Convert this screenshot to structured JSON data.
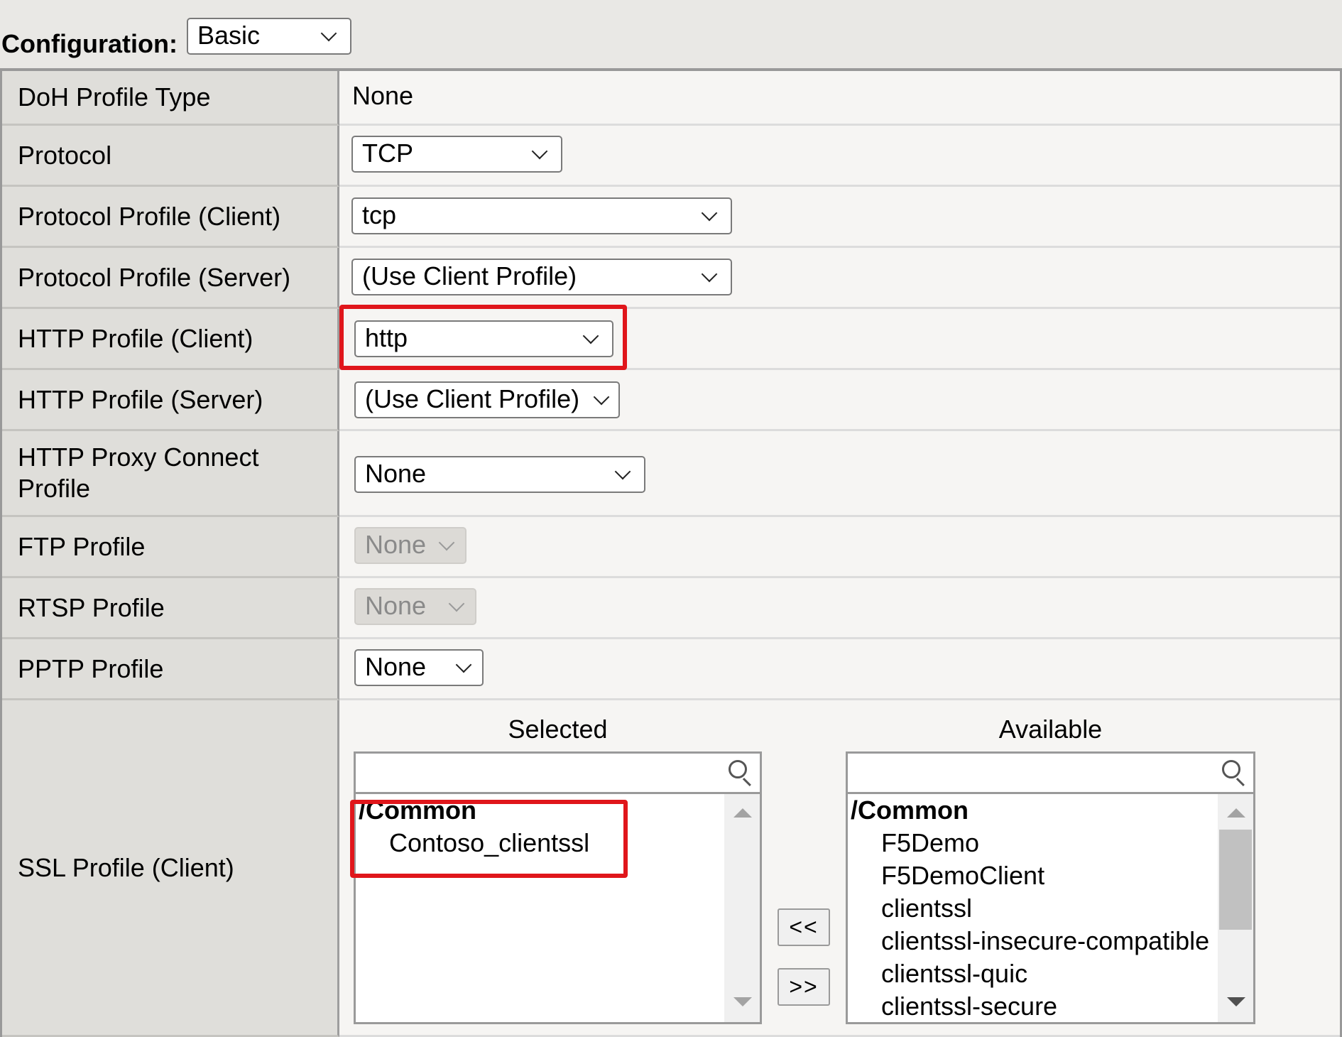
{
  "config": {
    "label": "Configuration:",
    "value": "Basic"
  },
  "rows": {
    "doh": {
      "label": "DoH Profile Type",
      "value": "None"
    },
    "protocol": {
      "label": "Protocol",
      "value": "TCP"
    },
    "protocol_client": {
      "label": "Protocol Profile (Client)",
      "value": "tcp"
    },
    "protocol_server": {
      "label": "Protocol Profile (Server)",
      "value": "(Use Client Profile)"
    },
    "http_client": {
      "label": "HTTP Profile (Client)",
      "value": "http",
      "highlighted": true
    },
    "http_server": {
      "label": "HTTP Profile (Server)",
      "value": "(Use Client Profile)"
    },
    "http_proxy": {
      "label_line1": "HTTP Proxy Connect",
      "label_line2": "Profile",
      "value": "None"
    },
    "ftp": {
      "label": "FTP Profile",
      "value": "None",
      "disabled": true
    },
    "rtsp": {
      "label": "RTSP Profile",
      "value": "None",
      "disabled": true
    },
    "pptp": {
      "label": "PPTP Profile",
      "value": "None"
    },
    "ssl_client": {
      "label": "SSL Profile (Client)",
      "selected": {
        "heading": "Selected",
        "search_value": "",
        "group": "/Common",
        "items": [
          "Contoso_clientssl"
        ],
        "highlighted": true
      },
      "buttons": {
        "add": "<<",
        "remove": ">>"
      },
      "available": {
        "heading": "Available",
        "search_value": "",
        "group": "/Common",
        "items": [
          "F5Demo",
          "F5DemoClient",
          "clientssl",
          "clientssl-insecure-compatible",
          "clientssl-quic",
          "clientssl-secure"
        ]
      }
    }
  },
  "colors": {
    "highlight": "#e0161b",
    "label_bg": "#dfdeda",
    "value_bg": "#f6f5f3",
    "page_bg": "#e9e8e5"
  }
}
